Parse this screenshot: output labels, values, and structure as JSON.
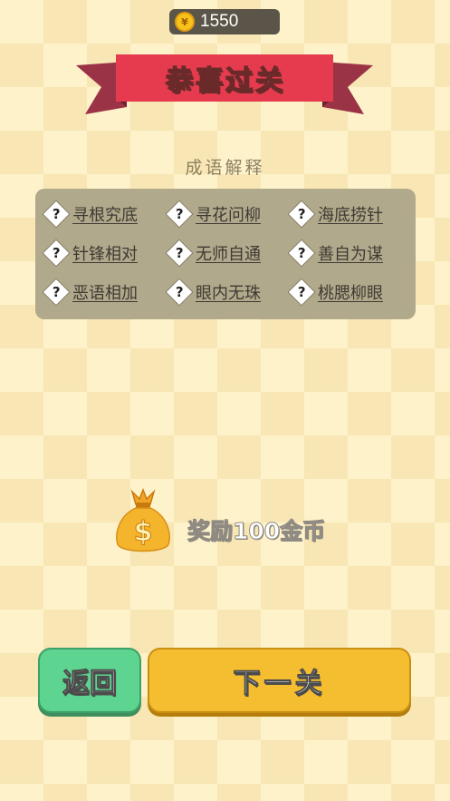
{
  "header": {
    "coins": "1550",
    "coin_icon_symbol": "¥"
  },
  "banner": {
    "title": "恭喜过关"
  },
  "section": {
    "title": "成语解释"
  },
  "idioms": [
    {
      "text": "寻根究底",
      "icon": "?"
    },
    {
      "text": "寻花问柳",
      "icon": "?"
    },
    {
      "text": "海底捞针",
      "icon": "?"
    },
    {
      "text": "针锋相对",
      "icon": "?"
    },
    {
      "text": "无师自通",
      "icon": "?"
    },
    {
      "text": "善自为谋",
      "icon": "?"
    },
    {
      "text": "恶语相加",
      "icon": "?"
    },
    {
      "text": "眼内无珠",
      "icon": "?"
    },
    {
      "text": "桃腮柳眼",
      "icon": "?"
    }
  ],
  "reward": {
    "text": "奖励100金币",
    "bag_symbol": "$"
  },
  "buttons": {
    "back": "返回",
    "next": "下一关"
  },
  "colors": {
    "accent_red": "#e63b4f",
    "ribbon_dark": "#9b3347",
    "panel": "#b1a98b",
    "back_green": "#5dd48f",
    "next_yellow": "#f5bd30",
    "coin_gold": "#f6c21c"
  }
}
